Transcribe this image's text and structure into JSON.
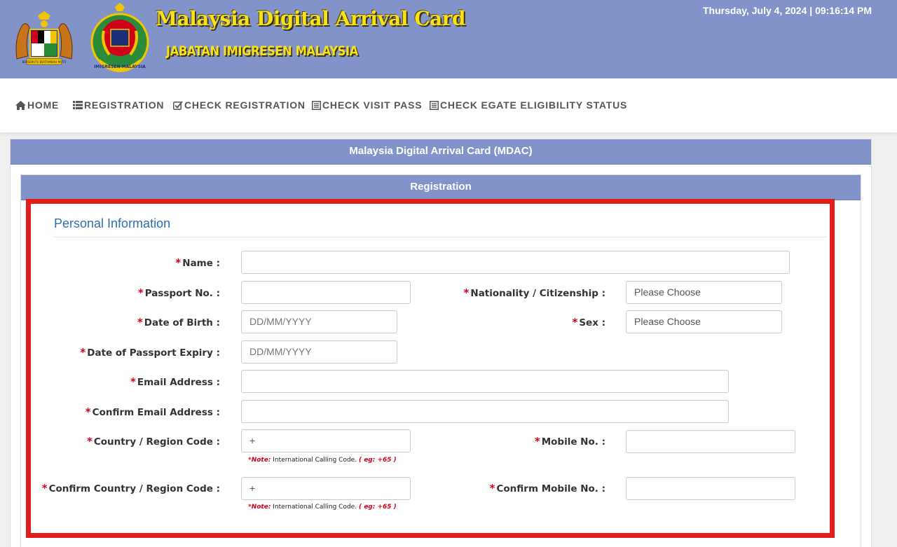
{
  "header": {
    "datetime": "Thursday, July 4, 2024 | 09:16:14 PM",
    "title": "Malaysia Digital Arrival Card",
    "subtitle": "JABATAN IMIGRESEN MALAYSIA",
    "crest_text": "BERSEKUTU BERTAMBAH MUTU",
    "imm_logo_text": "IMIGRESEN MALAYSIA"
  },
  "nav": {
    "items": [
      {
        "label": "HOME",
        "icon": "home-icon"
      },
      {
        "label": "REGISTRATION",
        "icon": "list-icon"
      },
      {
        "label": "CHECK REGISTRATION",
        "icon": "check-square-icon"
      },
      {
        "label": "CHECK VISIT PASS",
        "icon": "document-icon"
      },
      {
        "label": "CHECK EGATE ELIGIBILITY STATUS",
        "icon": "document-icon"
      }
    ]
  },
  "panel": {
    "title": "Malaysia Digital Arrival Card (MDAC)",
    "subtitle": "Registration"
  },
  "section": {
    "title": "Personal Information"
  },
  "form": {
    "required_mark": "*",
    "name": {
      "label": "Name :",
      "value": ""
    },
    "passport_no": {
      "label": "Passport No. :",
      "value": ""
    },
    "nationality": {
      "label": "Nationality / Citizenship :",
      "value": "Please Choose"
    },
    "dob": {
      "label": "Date of Birth :",
      "placeholder": "DD/MM/YYYY"
    },
    "sex": {
      "label": "Sex :",
      "value": "Please Choose"
    },
    "passport_expiry": {
      "label": "Date of Passport Expiry :",
      "placeholder": "DD/MM/YYYY"
    },
    "email": {
      "label": "Email Address :",
      "value": ""
    },
    "confirm_email": {
      "label": "Confirm Email Address :",
      "value": ""
    },
    "region_code": {
      "label": "Country / Region Code :",
      "value": "+"
    },
    "mobile": {
      "label": "Mobile No. :",
      "value": ""
    },
    "confirm_region_code": {
      "label": "Confirm Country / Region Code :",
      "value": "+"
    },
    "confirm_mobile": {
      "label": "Confirm Mobile No. :",
      "value": ""
    },
    "note": {
      "prefix": "*Note:",
      "text": " International Calling Code. ",
      "example": "( eg: +65 )"
    }
  },
  "colors": {
    "header_bg": "#8193c9",
    "title_yellow": "#f7e11a",
    "highlight_red": "#e31c1c",
    "section_blue": "#2f6fb0",
    "required_red": "#d0021b"
  }
}
